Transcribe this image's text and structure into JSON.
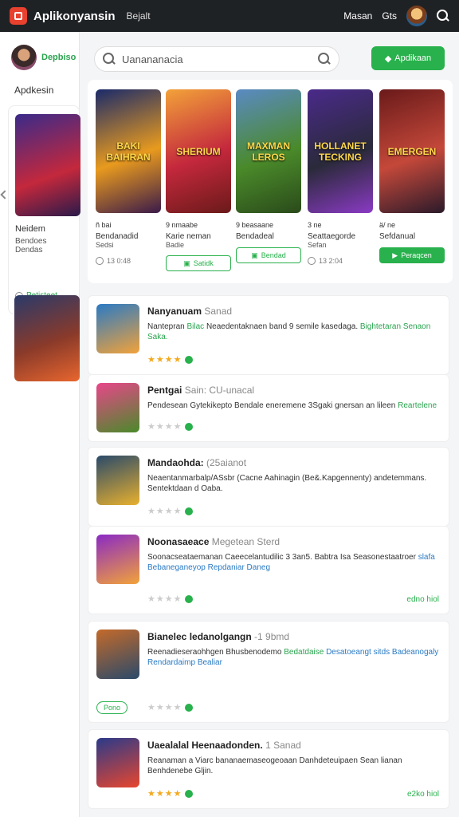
{
  "topbar": {
    "title": "Aplikonyansin",
    "link": "Bejalt",
    "right_label": "Masan",
    "right_label2": "Gts"
  },
  "sidebar": {
    "user": "Depbiso",
    "heading": "Apdkesin",
    "card": {
      "title": "Neidem",
      "subtitle": "Bendoes\nDendas",
      "button": "Petisteet"
    }
  },
  "search": {
    "placeholder": "Uanananacia",
    "value": "Uanananacia",
    "cta": "Apdikaan"
  },
  "featured": [
    {
      "art": "BAKI BAIHRAN",
      "meta": "ñ  bai",
      "title": "Bendanadid",
      "sub": "Sedsi",
      "action": "13 0:48",
      "action_type": "like"
    },
    {
      "art": "SHERIUM",
      "meta": "9  nmaabe",
      "title": "Karie neman",
      "sub": "Badie",
      "action": "Satidk",
      "action_type": "btn"
    },
    {
      "art": "MAXMAN LEROS",
      "meta": "9  beasaane",
      "title": "Bendadeal",
      "sub": "",
      "action": "Bendad",
      "action_type": "btn"
    },
    {
      "art": "HOLLANET TECKING",
      "meta": "3  ne",
      "title": "Seattaegorde",
      "sub": "Sefan",
      "action": "13 2:04",
      "action_type": "like"
    },
    {
      "art": "EMERGEN",
      "meta": "ä/  ne",
      "title": "Sefdanual",
      "sub": "",
      "action": "Peraqcen",
      "action_type": "solid"
    }
  ],
  "apps": [
    {
      "title": "Nanyanuam",
      "tag": "Sanad",
      "desc_pre": "Nantepran",
      "desc_hl1": "Bilac",
      "desc_mid": "Neaedentaknaen band 9 semile kasedaga.",
      "desc_hl2": "Bightetaran Senaon Saka.",
      "stars_on": "★★★★",
      "stars_off": "",
      "right": "",
      "pill": ""
    },
    {
      "title": "Pentgai",
      "tag": "Sain: CU-unacal",
      "desc_pre": "Pendesean Gytekikepto Bendale eneremene 3Sgaki gnersan an lileen",
      "desc_hl1": "Reartelene",
      "desc_mid": "",
      "desc_hl2": "",
      "stars_on": "",
      "stars_off": "★★★★",
      "right": "",
      "pill": ""
    },
    {
      "title": "Mandaohda:",
      "tag": "(25aianot",
      "desc_pre": "Neaentanmarbalp/ASsbr (Cacne Aahinagin (Be&.Kapgennenty) andetemmans. Sentektdaan d Oaba.",
      "desc_hl1": "",
      "desc_mid": "",
      "desc_hl2": "",
      "stars_on": "",
      "stars_off": "★★★★",
      "right": "",
      "pill": ""
    },
    {
      "title": "Noonasaeace",
      "tag": "Megetean Sterd",
      "desc_pre": "Soonacseataemanan Caeecelantudilic 3 3an5.",
      "desc_hl1": "Babtra Isa Seasonestaatroer",
      "desc_mid": "slafa Bebaneganeyop",
      "desc_hl2": "Repdaniar Daneg",
      "stars_on": "",
      "stars_off": "★★★★",
      "right": "edno hiol",
      "pill": ""
    },
    {
      "title": "Bianelec ledanolgangn",
      "tag": "-1 9bmd",
      "desc_pre": "Reenadieseraohhgen Bhusbenodemo",
      "desc_hl1": "Bedatdaise",
      "desc_mid": "Desatoeangt  sitds Badeanogaly",
      "desc_hl2": "Rendardaimp Bealiar",
      "stars_on": "",
      "stars_off": "★★★★",
      "right": "",
      "pill": "Pono"
    },
    {
      "title": "Uaealalal Heenaadonden.",
      "tag": "1 Sanad",
      "desc_pre": "Reanaman a Viarc bananaemaseogeoaan Danhdeteuipaen Sean lianan Benhdenebe Gljin.",
      "desc_hl1": "",
      "desc_mid": "",
      "desc_hl2": "",
      "stars_on": "★★★★",
      "stars_off": "",
      "right": "e2ko hiol",
      "pill": ""
    }
  ],
  "colors": {
    "accent": "#28b14c",
    "topbar": "#1f2225",
    "brand": "#e8412e"
  }
}
